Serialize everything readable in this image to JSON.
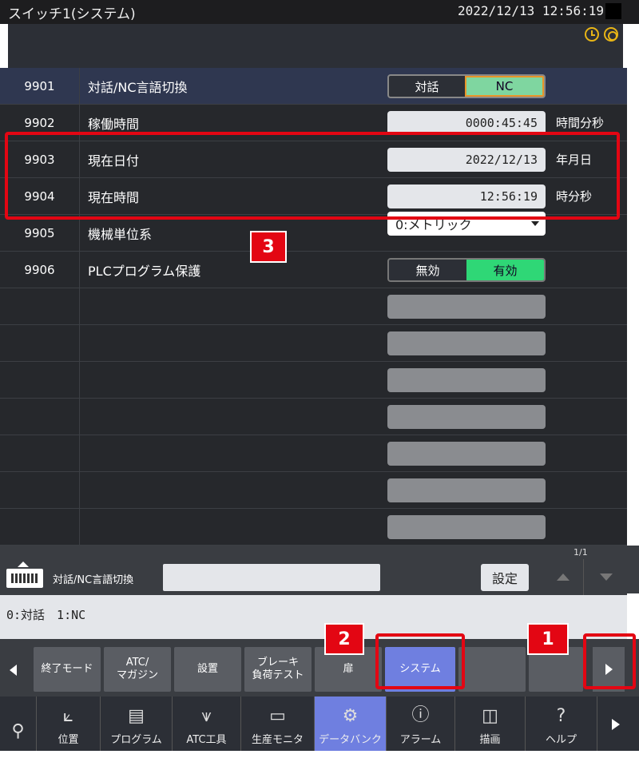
{
  "header": {
    "title": "スイッチ1(システム)",
    "datetime": "2022/12/13 12:56:19",
    "icons": [
      "clock-icon",
      "sync-icon"
    ]
  },
  "table": {
    "rows": [
      {
        "num": "9901",
        "label": "対話/NC言語切換",
        "type": "toggle",
        "options": [
          "対話",
          "NC"
        ],
        "selected": "NC"
      },
      {
        "num": "9902",
        "label": "稼働時間",
        "type": "value",
        "value": "0000:45:45",
        "unit": "時間分秒"
      },
      {
        "num": "9903",
        "label": "現在日付",
        "type": "value",
        "value": "2022/12/13",
        "unit": "年月日"
      },
      {
        "num": "9904",
        "label": "現在時間",
        "type": "value",
        "value": "12:56:19",
        "unit": "時分秒"
      },
      {
        "num": "9905",
        "label": "機械単位系",
        "type": "dropdown",
        "value": "0:メトリック"
      },
      {
        "num": "9906",
        "label": "PLCプログラム保護",
        "type": "toggle",
        "options": [
          "無効",
          "有効"
        ],
        "selected": "有効"
      }
    ]
  },
  "badges": {
    "b1": "1",
    "b2": "2",
    "b3": "3"
  },
  "input": {
    "label": "対話/NC言語切換",
    "value": "",
    "set_label": "設定",
    "page": "1/1"
  },
  "help_text": "0:対話　1:NC",
  "fkeys": [
    "終了モード",
    "ATC/\nマガジン",
    "設置",
    "ブレーキ\n負荷テスト",
    "扉",
    "システム",
    "",
    ""
  ],
  "fkeys_selected": "システム",
  "nav": [
    {
      "label": "",
      "icon": "tool-icon"
    },
    {
      "label": "位置",
      "icon": "axis-icon"
    },
    {
      "label": "プログラム",
      "icon": "program-icon"
    },
    {
      "label": "ATC工具",
      "icon": "atc-tool-icon"
    },
    {
      "label": "生産モニタ",
      "icon": "monitor-icon"
    },
    {
      "label": "データバンク",
      "icon": "gear-icon"
    },
    {
      "label": "アラーム",
      "icon": "alarm-icon"
    },
    {
      "label": "描画",
      "icon": "cube-icon"
    },
    {
      "label": "ヘルプ",
      "icon": "help-icon"
    }
  ],
  "nav_selected": "データバンク",
  "colors": {
    "highlight_red": "#e30613",
    "accent_blue": "#6f7fe0",
    "toggle_green": "#2fd776",
    "toggle_nc": "#7fd6a0"
  }
}
